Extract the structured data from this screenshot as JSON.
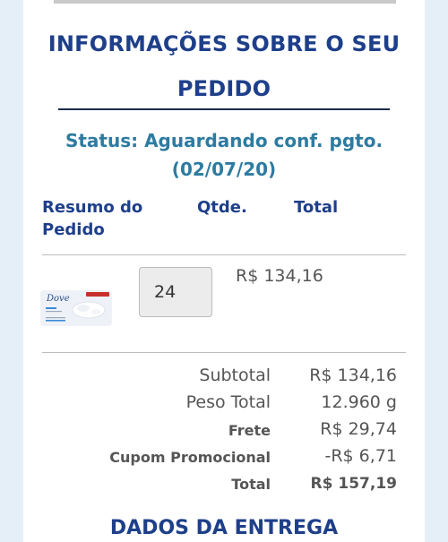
{
  "order": {
    "title": "INFORMAÇÕES SOBRE O SEU PEDIDO",
    "status": "Status: Aguardando conf. pgto. (02/07/20)"
  },
  "table": {
    "headers": {
      "summary": "Resumo do Pedido",
      "qty": "Qtde.",
      "total": "Total"
    },
    "items": [
      {
        "product_brand": "Dove",
        "quantity": "24",
        "price": "R$ 134,16"
      }
    ]
  },
  "summary": {
    "subtotal_label": "Subtotal",
    "subtotal_value": "R$ 134,16",
    "weight_label": "Peso Total",
    "weight_value": "12.960 g",
    "shipping_label": "Frete",
    "shipping_value": "R$ 29,74",
    "coupon_label": "Cupom Promocional",
    "coupon_value": "-R$ 6,71",
    "total_label": "Total",
    "total_value": "R$ 157,19"
  },
  "delivery": {
    "title": "DADOS DA ENTREGA"
  },
  "colors": {
    "page_background": "#e5eff8",
    "heading_blue": "#1e3f8a",
    "status_teal": "#2d7ba1",
    "text_gray": "#555555"
  }
}
